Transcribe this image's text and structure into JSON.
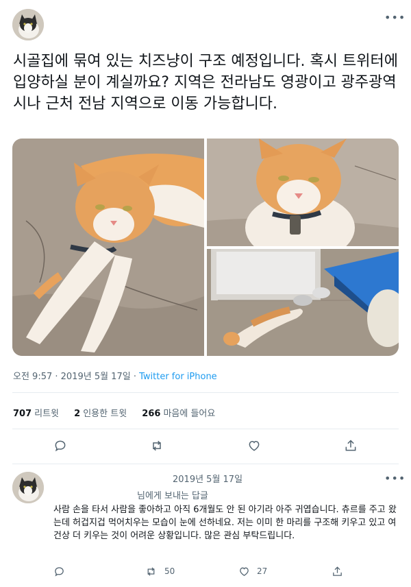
{
  "tweet": {
    "text": "시골집에 묶여 있는 치즈냥이 구조 예정입니다. 혹시 트위터에 입양하실 분이 계실까요? 지역은 전라남도 영광이고 광주광역시나 근처 전남 지역으로 이동 가능합니다.",
    "time": "오전 9:57 · 2019년 5월 17일 · ",
    "source": "Twitter for iPhone",
    "stats": {
      "retweets_count": "707",
      "retweets_label": "리트윗",
      "quotes_count": "2",
      "quotes_label": "인용한 트윗",
      "likes_count": "266",
      "likes_label": "마음에 들어요"
    },
    "actions": [
      "reply-icon",
      "retweet-icon",
      "like-icon",
      "share-icon"
    ]
  },
  "reply": {
    "date": "2019년 5월 17일",
    "replying_to": "님에게 보내는 답글",
    "text": "사람 손을 타서 사람을 좋아하고 아직 6개월도 안 된 아기라 아주 귀엽습니다. 츄르를 주고 왔는데 허겁지겁 먹어치우는 모습이 눈에 선하네요. 저는 이미 한 마리를 구조해 키우고 있고 여건상 더 키우는 것이 어려운 상황입니다. 많은 관심 부탁드립니다.",
    "retweets": "50",
    "likes": "27"
  },
  "colors": {
    "accent": "#1d9bf0",
    "secondary_text": "#536471",
    "divider": "#e6ecf0"
  }
}
